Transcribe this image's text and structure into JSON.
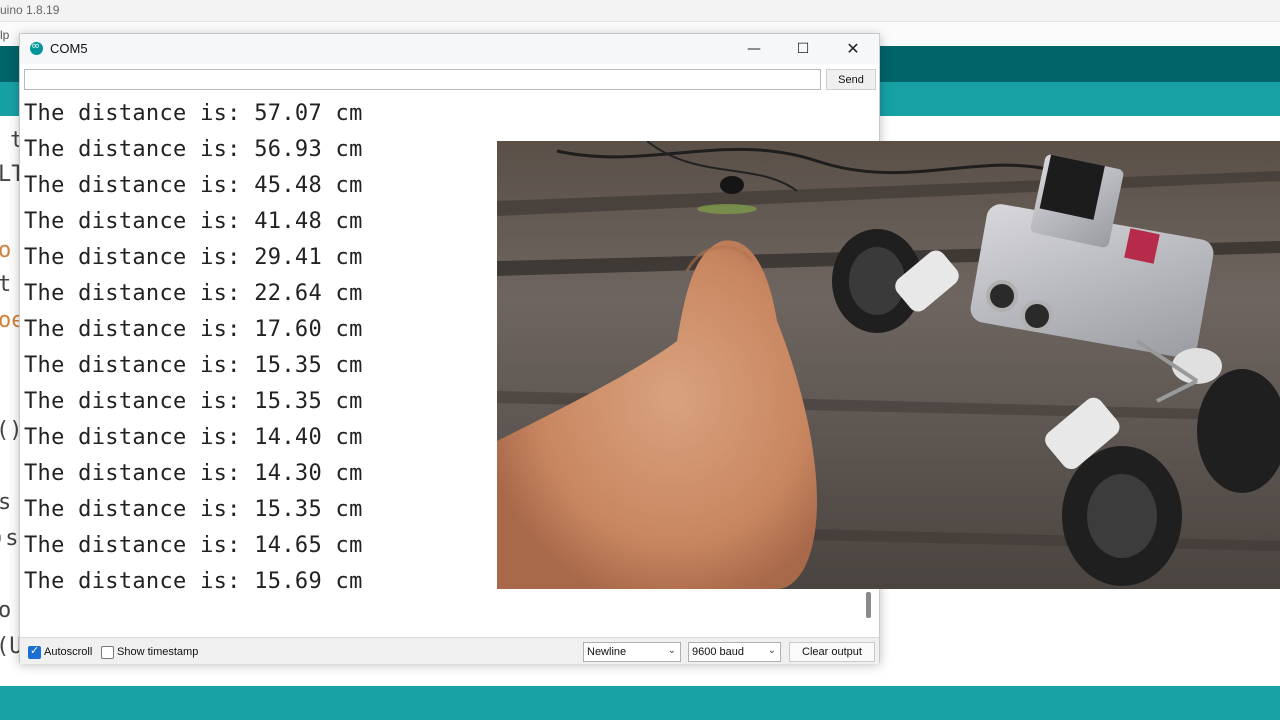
{
  "ide": {
    "title": "uino 1.8.19",
    "menu": "lp",
    "code_fragments": [
      "t",
      "LT",
      "o",
      "t",
      "oe",
      "()",
      "s",
      ")s",
      "o",
      "(U"
    ]
  },
  "monitor": {
    "title": "COM5",
    "input_value": "",
    "send_label": "Send",
    "output_lines": [
      "The distance is: 57.07 cm",
      "The distance is: 56.93 cm",
      "The distance is: 45.48 cm",
      "The distance is: 41.48 cm",
      "The distance is: 29.41 cm",
      "The distance is: 22.64 cm",
      "The distance is: 17.60 cm",
      "The distance is: 15.35 cm",
      "The distance is: 15.35 cm",
      "The distance is: 14.40 cm",
      "The distance is: 14.30 cm",
      "The distance is: 15.35 cm",
      "The distance is: 14.65 cm",
      "The distance is: 15.69 cm"
    ],
    "autoscroll_label": "Autoscroll",
    "autoscroll_checked": true,
    "timestamp_label": "Show timestamp",
    "timestamp_checked": false,
    "line_ending": "Newline",
    "baud": "9600 baud",
    "clear_label": "Clear output"
  },
  "icons": {
    "minimize": "minimize-icon",
    "maximize": "maximize-icon",
    "close": "close-icon",
    "dropdown": "chevron-down-icon"
  },
  "colors": {
    "ide_toolbar": "#006468",
    "ide_tabs": "#17a1a5",
    "checkbox_accent": "#1b6fd1"
  }
}
